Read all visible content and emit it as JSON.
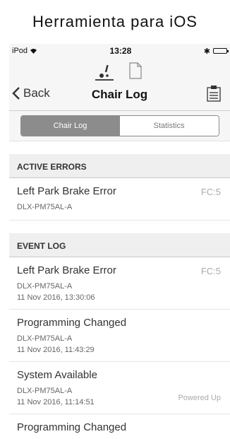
{
  "caption": "Herramienta  para  iOS",
  "status": {
    "carrier": "iPod",
    "time": "13:28",
    "bluetooth": "✱"
  },
  "nav": {
    "back_label": "Back",
    "title": "Chair Log"
  },
  "segments": {
    "left": "Chair Log",
    "right": "Statistics"
  },
  "active_errors": {
    "header": "ACTIVE ERRORS",
    "items": [
      {
        "name": "Left Park Brake Error",
        "model": "DLX-PM75AL-A",
        "code": "FC:5"
      }
    ]
  },
  "event_log": {
    "header": "EVENT LOG",
    "items": [
      {
        "name": "Left Park Brake Error",
        "model": "DLX-PM75AL-A",
        "time": "11 Nov 2016, 13:30:06",
        "code": "FC:5",
        "tag": ""
      },
      {
        "name": "Programming Changed",
        "model": "DLX-PM75AL-A",
        "time": "11 Nov 2016, 11:43:29",
        "code": "",
        "tag": ""
      },
      {
        "name": "System Available",
        "model": "DLX-PM75AL-A",
        "time": "11 Nov 2016, 11:14:51",
        "code": "",
        "tag": "Powered Up"
      },
      {
        "name": "Programming Changed",
        "model": "",
        "time": "",
        "code": "",
        "tag": ""
      }
    ]
  },
  "colors": {
    "bar_bg": "#f6f6f6",
    "section_bg": "#efefef",
    "segment_active": "#8c8c8c"
  }
}
